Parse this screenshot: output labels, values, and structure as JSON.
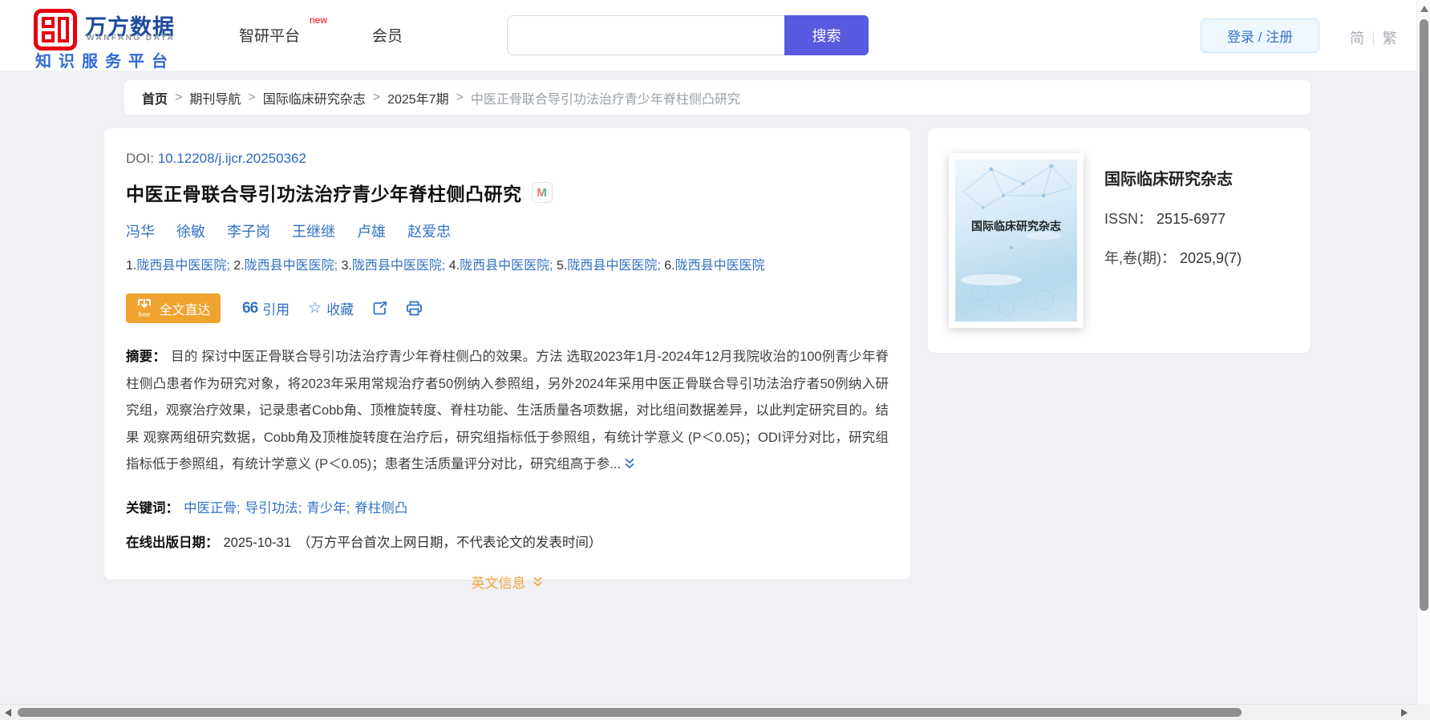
{
  "header": {
    "logo": {
      "brand_cn": "万方数据",
      "brand_en": "WANFANG DATA",
      "tagline": "知识服务平台"
    },
    "nav": {
      "platform": "智研平台",
      "platform_badge": "new",
      "member": "会员"
    },
    "search": {
      "placeholder": "",
      "button": "搜索"
    },
    "account": {
      "login": "登录 / 注册"
    },
    "lang": {
      "simplified": "简",
      "divider": "|",
      "traditional": "繁"
    }
  },
  "breadcrumb": {
    "separator": ">",
    "items": [
      "首页",
      "期刊导航",
      "国际临床研究杂志",
      "2025年7期"
    ],
    "current": "中医正骨联合导引功法治疗青少年脊柱侧凸研究"
  },
  "article": {
    "doi_label": "DOI:",
    "doi": "10.12208/j.ijcr.20250362",
    "title": "中医正骨联合导引功法治疗青少年脊柱侧凸研究",
    "title_badge": "M",
    "authors": [
      "冯华",
      "徐敏",
      "李子岗",
      "王继继",
      "卢雄",
      "赵爱忠"
    ],
    "affil_sep": "; ",
    "affiliations": [
      {
        "num": "1.",
        "name": "陇西县中医医院"
      },
      {
        "num": "2.",
        "name": "陇西县中医医院"
      },
      {
        "num": "3.",
        "name": "陇西县中医医院"
      },
      {
        "num": "4.",
        "name": "陇西县中医医院"
      },
      {
        "num": "5.",
        "name": "陇西县中医医院"
      },
      {
        "num": "6.",
        "name": "陇西县中医医院"
      }
    ],
    "actions": {
      "fulltext": "全文直达",
      "fulltext_tag": "free",
      "cite_icon": "66",
      "cite": "引用",
      "favorite_icon": "☆",
      "favorite": "收藏"
    },
    "abstract_label": "摘要：",
    "abstract": "目的 探讨中医正骨联合导引功法治疗青少年脊柱侧凸的效果。方法 选取2023年1月-2024年12月我院收治的100例青少年脊柱侧凸患者作为研究对象，将2023年采用常规治疗者50例纳入参照组，另外2024年采用中医正骨联合导引功法治疗者50例纳入研究组，观察治疗效果，记录患者Cobb角、顶椎旋转度、脊柱功能、生活质量各项数据，对比组间数据差异，以此判定研究目的。结果 观察两组研究数据，Cobb角及顶椎旋转度在治疗后，研究组指标低于参照组，有统计学意义 (P＜0.05)；ODI评分对比，研究组指标低于参照组，有统计学意义 (P＜0.05)；患者生活质量评分对比，研究组高于参...",
    "keywords_label": "关键词：",
    "keyword_sep": ";",
    "keywords": [
      "中医正骨",
      "导引功法",
      "青少年",
      "脊柱侧凸"
    ],
    "pubdate_label": "在线出版日期：",
    "pubdate": "2025-10-31",
    "pubdate_note": "（万方平台首次上网日期，不代表论文的发表时间）",
    "english_toggle": "英文信息"
  },
  "journal": {
    "cover_text": "国际临床研究杂志",
    "name": "国际临床研究杂志",
    "issn_label": "ISSN：",
    "issn": "2515-6977",
    "issue_label": "年,卷(期)：",
    "issue": "2025,9(7)"
  },
  "colors": {
    "brand_red": "#e60012",
    "brand_blue": "#1f4ba0",
    "link_blue": "#3273c5",
    "search_purple": "#585ae0",
    "accent_orange": "#f0a330",
    "english_orange": "#f5a53c",
    "page_bg": "#f0f1f5"
  }
}
